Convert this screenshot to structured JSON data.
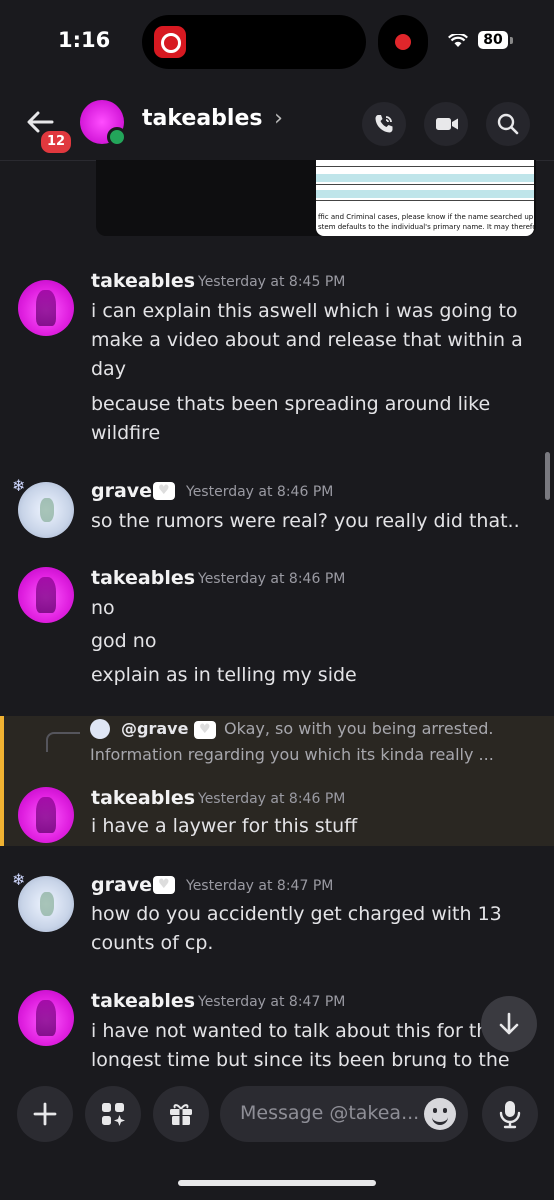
{
  "status": {
    "time": "1:16",
    "battery": "80"
  },
  "header": {
    "badge": "12",
    "name": "takeables",
    "chevron": "›"
  },
  "embed": {
    "doc_line1": "ffic and Criminal cases, please know if the name searched up",
    "doc_line2": "stem defaults to the individual's primary name. It may therefo"
  },
  "messages": [
    {
      "author": "takeables",
      "time": "Yesterday at 8:45 PM",
      "lines": [
        "i can explain this aswell which i was going to make a video about and release that within a day",
        "because thats been spreading around like wildfire"
      ]
    },
    {
      "author": "grave",
      "time": "Yesterday at 8:46 PM",
      "lines": [
        "so the rumors were real? you really did that.."
      ]
    },
    {
      "author": "takeables",
      "time": "Yesterday at 8:46 PM",
      "lines": [
        "no",
        "god no",
        "explain as in telling my side"
      ]
    },
    {
      "author": "takeables",
      "time": "Yesterday at 8:46 PM",
      "lines": [
        "i have a laywer for this stuff"
      ]
    },
    {
      "author": "grave",
      "time": "Yesterday at 8:47 PM",
      "lines": [
        "how do you accidently get charged with 13 counts of cp."
      ]
    },
    {
      "author": "takeables",
      "time": "Yesterday at 8:47 PM",
      "lines": [
        "i have not wanted to talk about this for th",
        "longest time but since its been brung to the"
      ]
    }
  ],
  "reply": {
    "name": "@grave",
    "text1": "Okay, so with you being arrested.",
    "text2": "Information regarding you which its kinda really ..."
  },
  "composer": {
    "placeholder": "Message @takea..."
  },
  "icons": [
    "back-arrow-icon",
    "phone-icon",
    "video-icon",
    "search-icon",
    "plus-icon",
    "apps-icon",
    "gift-icon",
    "emoji-icon",
    "mic-icon",
    "arrow-down-icon",
    "wifi-icon"
  ]
}
